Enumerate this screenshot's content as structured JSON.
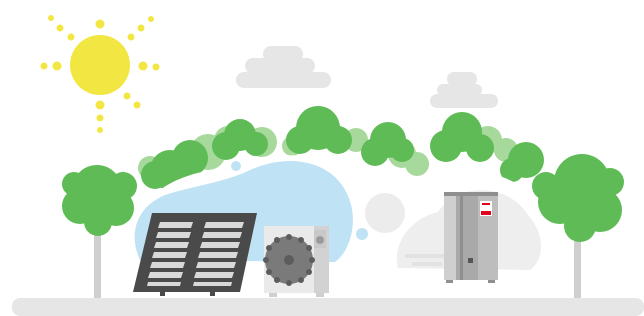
{
  "scene": {
    "elements": {
      "sun": "sun-icon",
      "clouds": [
        "cloud-icon",
        "cloud-icon"
      ],
      "trees": [
        "tree-icon",
        "tree-icon",
        "tree-icon"
      ],
      "solar_panel": "solar-panel-icon",
      "outdoor_unit": "heat-pump-outdoor-unit-icon",
      "indoor_unit": "heat-pump-indoor-unit-icon"
    },
    "colors": {
      "sun": "#f2e742",
      "tree_dark": "#5ebb55",
      "tree_light": "#a7d89c",
      "trunk": "#c9c9c9",
      "sky_blue": "#bfe3f5",
      "cloud_grey": "#e4e4e4",
      "panel_dark": "#4a4a4a",
      "unit_grey": "#c4c4c4",
      "brand_red": "#e2001a",
      "ground": "#e6e6e6"
    }
  }
}
